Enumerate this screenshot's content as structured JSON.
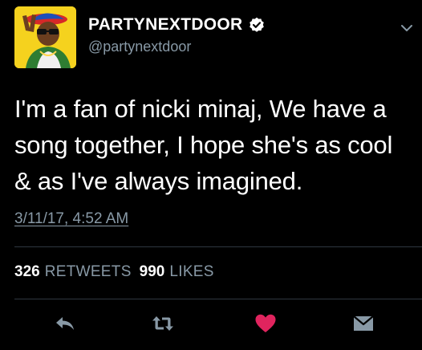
{
  "profile": {
    "display_name": "PARTYNEXTDOOR",
    "handle": "@partynextdoor"
  },
  "tweet": {
    "text": "I'm a fan of nicki minaj, We have a song together, I hope she's as cool & as I've always imagined.",
    "timestamp": "3/11/17, 4:52 AM"
  },
  "stats": {
    "retweets_count": "326",
    "retweets_label": "RETWEETS",
    "likes_count": "990",
    "likes_label": "LIKES"
  },
  "icons": {
    "verified": "verified-badge-icon",
    "menu": "chevron-down-icon",
    "reply": "reply-icon",
    "retweet": "retweet-icon",
    "like": "heart-icon",
    "message": "direct-message-icon"
  },
  "colors": {
    "background": "#000000",
    "secondary_text": "#8899a6",
    "like_active": "#e0245e",
    "divider": "#2f3740"
  }
}
